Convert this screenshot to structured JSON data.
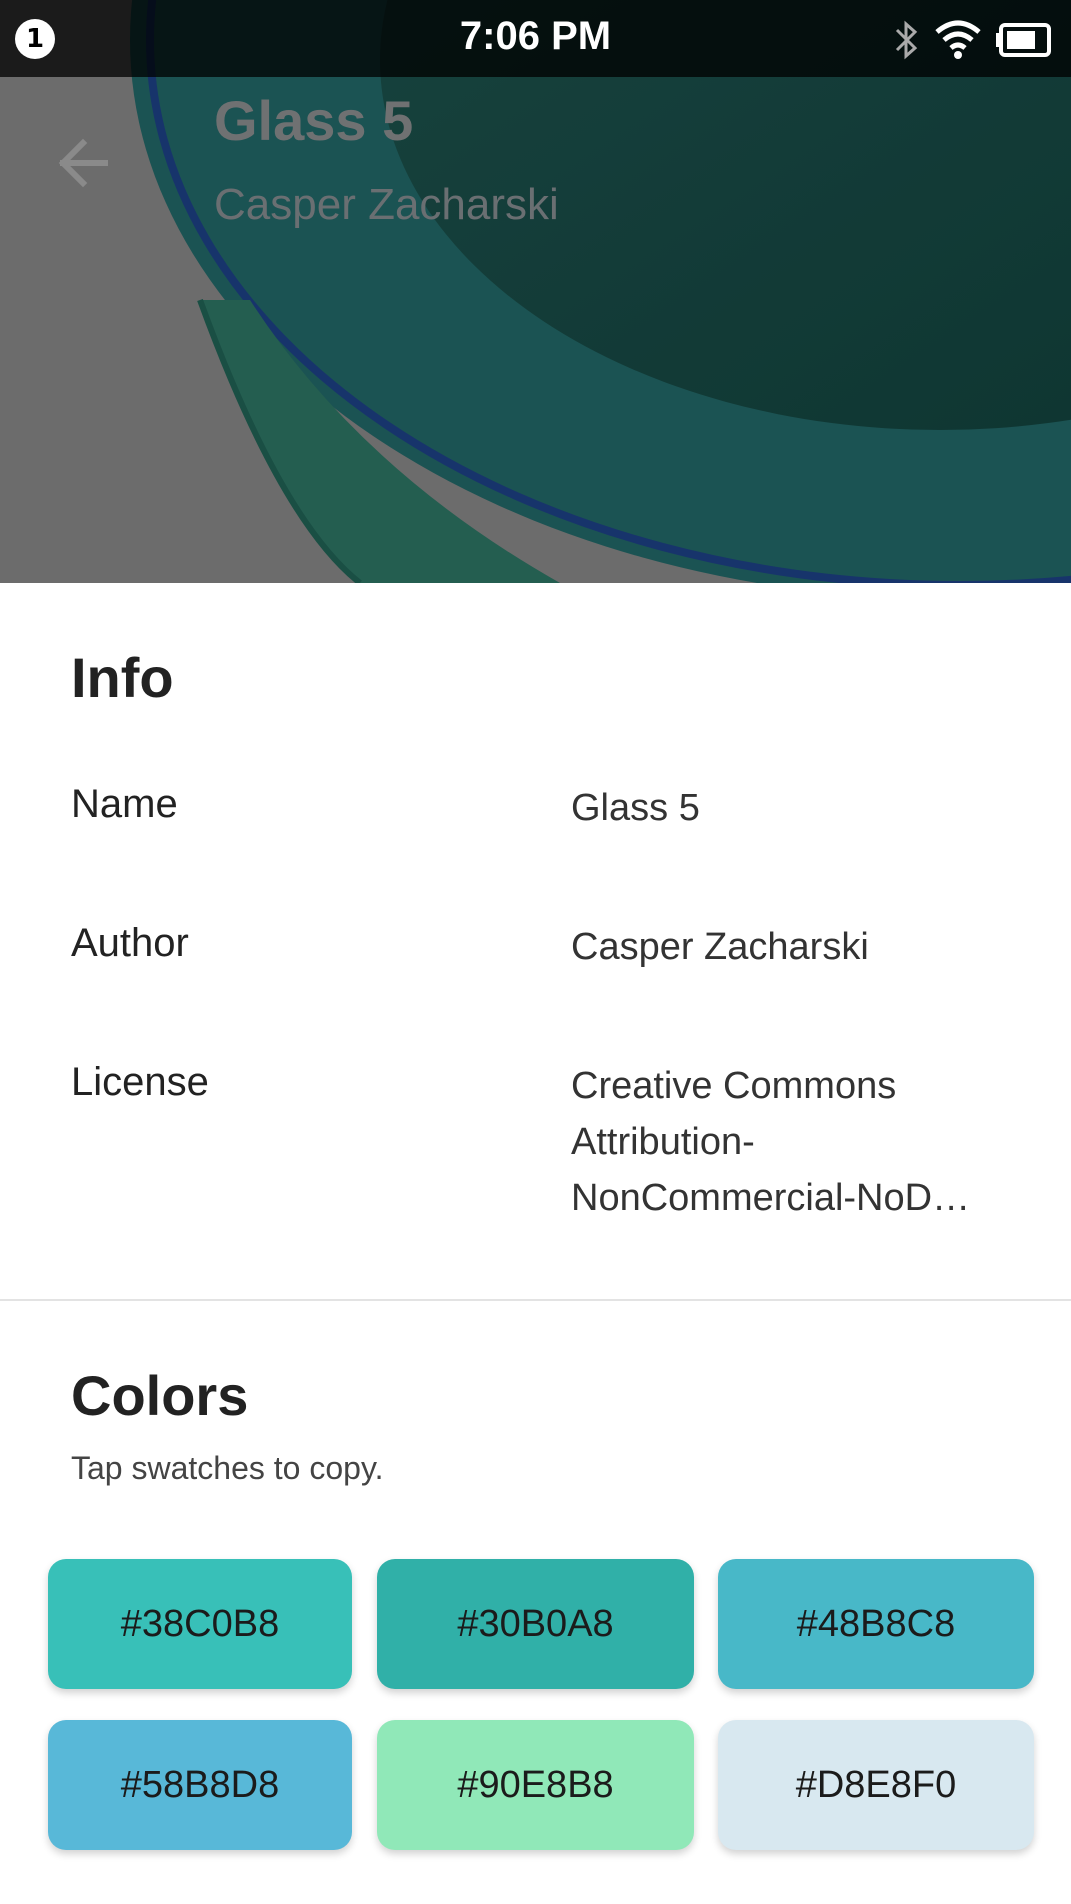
{
  "status_bar": {
    "notification_count": "1",
    "time": "7:06 PM",
    "icons": [
      "bluetooth-icon",
      "wifi-icon",
      "battery-icon"
    ]
  },
  "header": {
    "back_icon": "arrow-left-icon",
    "title": "Glass 5",
    "subtitle": "Casper Zacharski"
  },
  "info": {
    "heading": "Info",
    "rows": [
      {
        "label": "Name",
        "value": "Glass 5"
      },
      {
        "label": "Author",
        "value": "Casper Zacharski"
      },
      {
        "label": "License",
        "value": "Creative Commons Attribution-NonCommercial-NoD…"
      }
    ]
  },
  "colors": {
    "heading": "Colors",
    "hint": "Tap swatches to copy.",
    "swatches": [
      {
        "hex": "#38C0B8"
      },
      {
        "hex": "#30B0A8"
      },
      {
        "hex": "#48B8C8"
      },
      {
        "hex": "#58B8D8"
      },
      {
        "hex": "#90E8B8"
      },
      {
        "hex": "#D8E8F0"
      }
    ]
  }
}
